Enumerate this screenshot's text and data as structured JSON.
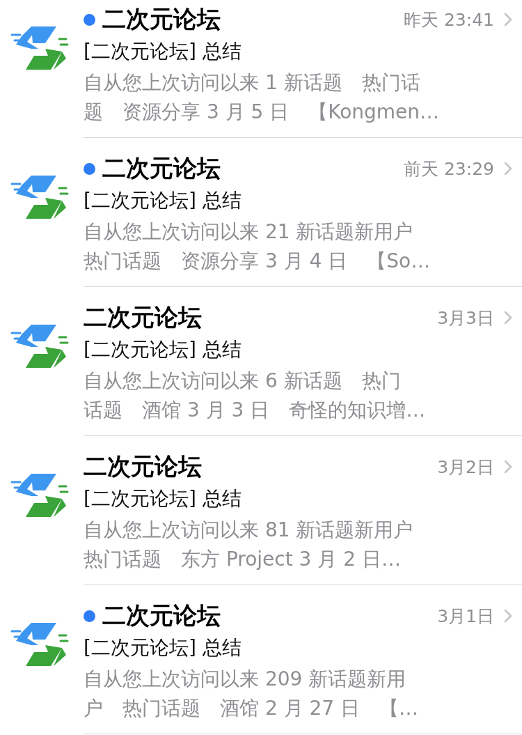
{
  "messages": [
    {
      "sender": "二次元论坛",
      "unread": true,
      "date": "昨天 23:41",
      "subject": "[二次元论坛] 总结",
      "preview_lines": [
        "自从您上次访问以来 1 新话题　热门话",
        "题　资源分享 3 月 5 日　【Kongmen…"
      ]
    },
    {
      "sender": "二次元论坛",
      "unread": true,
      "date": "前天 23:29",
      "subject": "[二次元论坛] 总结",
      "preview_lines": [
        "自从您上次访问以来 21 新话题新用户",
        "热门话题　资源分享 3 月 4 日　【So…"
      ]
    },
    {
      "sender": "二次元论坛",
      "unread": false,
      "date": "3月3日",
      "subject": "[二次元论坛] 总结",
      "preview_lines": [
        "自从您上次访问以来 6 新话题　热门",
        "话题　酒馆 3 月 3 日　奇怪的知识增…"
      ]
    },
    {
      "sender": "二次元论坛",
      "unread": false,
      "date": "3月2日",
      "subject": "[二次元论坛] 总结",
      "preview_lines": [
        "自从您上次访问以来 81 新话题新用户",
        "热门话题　东方 Project 3 月 2 日…"
      ]
    },
    {
      "sender": "二次元论坛",
      "unread": true,
      "date": "3月1日",
      "subject": "[二次元论坛] 总结",
      "preview_lines": [
        "自从您上次访问以来 209 新话题新用",
        "户　热门话题　酒馆 2 月 27 日　【…"
      ]
    }
  ]
}
